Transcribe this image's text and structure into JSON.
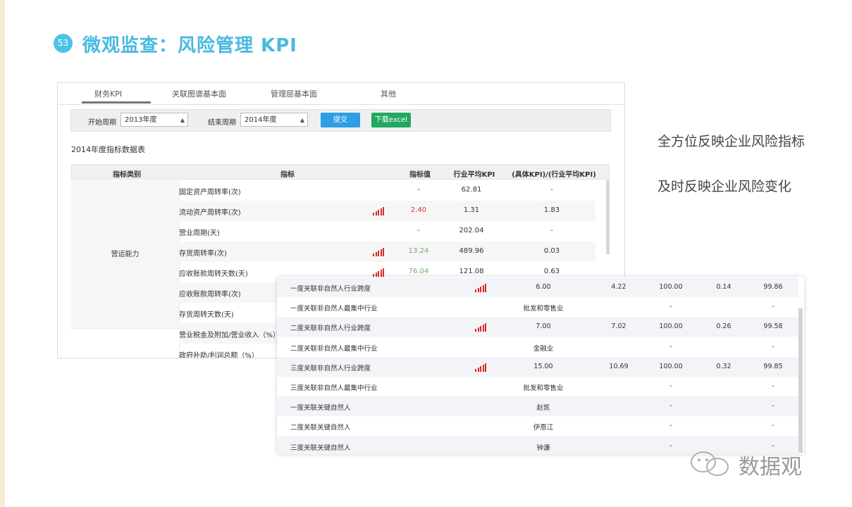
{
  "slide": {
    "number": "53",
    "title": "微观监查：风险管理 KPI"
  },
  "tabs": [
    "财务KPI",
    "关联图谱基本面",
    "管理层基本面",
    "其他"
  ],
  "filters": {
    "start_label": "开始周期",
    "start_value": "2013年度",
    "end_label": "结束周期",
    "end_value": "2014年度",
    "submit": "提交",
    "excel": "下载excel"
  },
  "table_caption": "2014年度指标数据表",
  "table_headers": [
    "指标类别",
    "指标",
    "指标值",
    "行业平均KPI",
    "(具体KPI)/(行业平均KPI)"
  ],
  "category": "营运能力",
  "kpi_rows": [
    {
      "name": "固定资产周转率(次)",
      "value": "-",
      "avg": "62.81",
      "ratio": "-",
      "signal": false,
      "value_color": "#333333"
    },
    {
      "name": "流动资产周转率(次)",
      "value": "2.40",
      "avg": "1.31",
      "ratio": "1.83",
      "signal": true,
      "value_color": "#d43a2a"
    },
    {
      "name": "营业周期(天)",
      "value": "-",
      "avg": "202.04",
      "ratio": "-",
      "signal": false,
      "value_color": "#333333"
    },
    {
      "name": "存货周转率(次)",
      "value": "13.24",
      "avg": "489.96",
      "ratio": "0.03",
      "signal": true,
      "value_color": "#6fb06f"
    },
    {
      "name": "应收账款周转天数(天)",
      "value": "76.04",
      "avg": "121.08",
      "ratio": "0.63",
      "signal": true,
      "value_color": "#6fb06f"
    },
    {
      "name": "应收账款周转率(次)",
      "value": "",
      "avg": "",
      "ratio": "",
      "signal": false,
      "value_color": "#333333"
    },
    {
      "name": "存货周转天数(天)",
      "value": "",
      "avg": "",
      "ratio": "",
      "signal": false,
      "value_color": "#333333"
    },
    {
      "name": "营业税金及附加/营业收入（%）",
      "value": "",
      "avg": "",
      "ratio": "",
      "signal": false,
      "value_color": "#333333"
    },
    {
      "name": "政府补助/利润总额（%）",
      "value": "",
      "avg": "",
      "ratio": "",
      "signal": false,
      "value_color": "#333333"
    }
  ],
  "relation_rows": [
    {
      "name": "一度关联非自然人行业跨度",
      "signal": true,
      "c1": "6.00",
      "c2": "4.22",
      "c3": "100.00",
      "c4": "0.14",
      "c5": "99.86"
    },
    {
      "name": "一度关联非自然人最集中行业",
      "signal": false,
      "c1": "批发和零售业",
      "c2": "",
      "c3": "-",
      "c4": "",
      "c5": "-"
    },
    {
      "name": "二度关联非自然人行业跨度",
      "signal": true,
      "c1": "7.00",
      "c2": "7.02",
      "c3": "100.00",
      "c4": "0.26",
      "c5": "99.58"
    },
    {
      "name": "二度关联非自然人最集中行业",
      "signal": false,
      "c1": "金融业",
      "c2": "",
      "c3": "-",
      "c4": "",
      "c5": "-"
    },
    {
      "name": "三度关联非自然人行业跨度",
      "signal": true,
      "c1": "15.00",
      "c2": "10.69",
      "c3": "100.00",
      "c4": "0.32",
      "c5": "99.85"
    },
    {
      "name": "三度关联非自然人最集中行业",
      "signal": false,
      "c1": "批发和零售业",
      "c2": "",
      "c3": "-",
      "c4": "",
      "c5": "-"
    },
    {
      "name": "一度关联关键自然人",
      "signal": false,
      "c1": "赵凯",
      "c2": "",
      "c3": "-",
      "c4": "",
      "c5": "-"
    },
    {
      "name": "二度关联关键自然人",
      "signal": false,
      "c1": "伊恩江",
      "c2": "",
      "c3": "-",
      "c4": "",
      "c5": "-"
    },
    {
      "name": "三度关联关键自然人",
      "signal": false,
      "c1": "钟濂",
      "c2": "",
      "c3": "-",
      "c4": "",
      "c5": "-"
    }
  ],
  "side_text": [
    "全方位反映企业风险指标",
    "及时反映企业风险变化"
  ],
  "watermark": "数据观",
  "colors": {
    "accent": "#49b9e0",
    "submit": "#2e9ee6",
    "excel": "#21a862",
    "signal": "#d42a2a"
  }
}
